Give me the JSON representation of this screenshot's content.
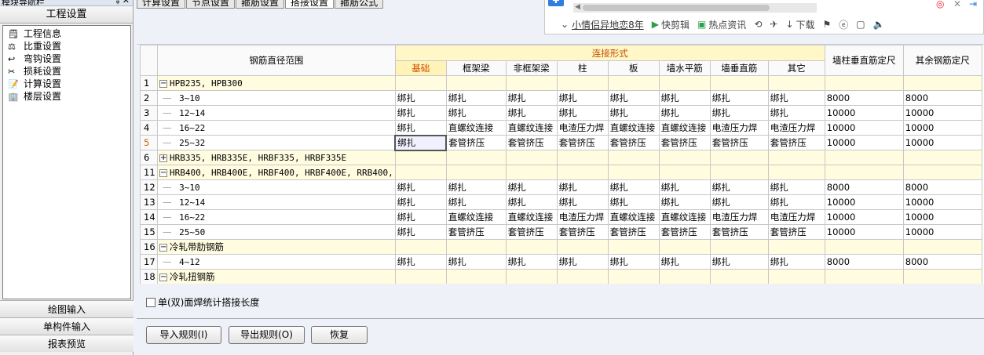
{
  "nav": {
    "window_title": "模块导航栏",
    "title_controls": "ᵩ ✕",
    "header": "工程设置",
    "items": [
      {
        "label": "工程信息",
        "icon": "info-doc-icon"
      },
      {
        "label": "比重设置",
        "icon": "weight-icon"
      },
      {
        "label": "弯钩设置",
        "icon": "hook-icon"
      },
      {
        "label": "损耗设置",
        "icon": "loss-icon"
      },
      {
        "label": "计算设置",
        "icon": "calc-icon"
      },
      {
        "label": "楼层设置",
        "icon": "floor-icon"
      }
    ],
    "bottom": [
      "绘图输入",
      "单构件输入",
      "报表预览"
    ]
  },
  "tabs": [
    {
      "label": "计算设置",
      "active": false
    },
    {
      "label": "节点设置",
      "active": false
    },
    {
      "label": "箍筋设置",
      "active": false
    },
    {
      "label": "搭接设置",
      "active": true
    },
    {
      "label": "箍筋公式",
      "active": false
    }
  ],
  "popup": {
    "news": "小情侣异地恋8年",
    "items": [
      "快剪辑",
      "热点资讯",
      "下载"
    ]
  },
  "grid": {
    "headers": {
      "range": "钢筋直径范围",
      "group": "连接形式",
      "sub": [
        "基础",
        "框架梁",
        "非框架梁",
        "柱",
        "板",
        "墙水平筋",
        "墙垂直筋",
        "其它"
      ],
      "wall": "墙柱垂直筋定尺",
      "other": "其余钢筋定尺"
    },
    "rows": [
      {
        "n": "1",
        "type": "group",
        "exp": "-",
        "label": "HPB235, HPB300"
      },
      {
        "n": "2",
        "type": "data",
        "label": "3~10",
        "cells": [
          "绑扎",
          "绑扎",
          "绑扎",
          "绑扎",
          "绑扎",
          "绑扎",
          "绑扎",
          "绑扎"
        ],
        "wall": "8000",
        "other": "8000"
      },
      {
        "n": "3",
        "type": "data",
        "label": "12~14",
        "cells": [
          "绑扎",
          "绑扎",
          "绑扎",
          "绑扎",
          "绑扎",
          "绑扎",
          "绑扎",
          "绑扎"
        ],
        "wall": "10000",
        "other": "10000"
      },
      {
        "n": "4",
        "type": "data",
        "label": "16~22",
        "cells": [
          "绑扎",
          "直螺纹连接",
          "直螺纹连接",
          "电渣压力焊",
          "直螺纹连接",
          "直螺纹连接",
          "电渣压力焊",
          "电渣压力焊"
        ],
        "wall": "10000",
        "other": "10000"
      },
      {
        "n": "5",
        "type": "data",
        "label": "25~32",
        "cur": true,
        "cells": [
          "绑扎",
          "套管挤压",
          "套管挤压",
          "套管挤压",
          "套管挤压",
          "套管挤压",
          "套管挤压",
          "套管挤压"
        ],
        "wall": "10000",
        "other": "10000"
      },
      {
        "n": "6",
        "type": "group",
        "exp": "+",
        "label": "HRB335, HRB335E, HRBF335, HRBF335E"
      },
      {
        "n": "11",
        "type": "group",
        "exp": "-",
        "label": "HRB400, HRB400E, HRBF400, HRBF400E, RRB400,"
      },
      {
        "n": "12",
        "type": "data",
        "label": "3~10",
        "cells": [
          "绑扎",
          "绑扎",
          "绑扎",
          "绑扎",
          "绑扎",
          "绑扎",
          "绑扎",
          "绑扎"
        ],
        "wall": "8000",
        "other": "8000"
      },
      {
        "n": "13",
        "type": "data",
        "label": "12~14",
        "cells": [
          "绑扎",
          "绑扎",
          "绑扎",
          "绑扎",
          "绑扎",
          "绑扎",
          "绑扎",
          "绑扎"
        ],
        "wall": "10000",
        "other": "10000"
      },
      {
        "n": "14",
        "type": "data",
        "label": "16~22",
        "cells": [
          "绑扎",
          "直螺纹连接",
          "直螺纹连接",
          "电渣压力焊",
          "直螺纹连接",
          "直螺纹连接",
          "电渣压力焊",
          "电渣压力焊"
        ],
        "wall": "10000",
        "other": "10000"
      },
      {
        "n": "15",
        "type": "data",
        "label": "25~50",
        "cells": [
          "绑扎",
          "套管挤压",
          "套管挤压",
          "套管挤压",
          "套管挤压",
          "套管挤压",
          "套管挤压",
          "套管挤压"
        ],
        "wall": "10000",
        "other": "10000"
      },
      {
        "n": "16",
        "type": "group",
        "exp": "-",
        "label": "冷轧带肋钢筋"
      },
      {
        "n": "17",
        "type": "data",
        "label": "4~12",
        "cells": [
          "绑扎",
          "绑扎",
          "绑扎",
          "绑扎",
          "绑扎",
          "绑扎",
          "绑扎",
          "绑扎"
        ],
        "wall": "8000",
        "other": "8000"
      },
      {
        "n": "18",
        "type": "group",
        "exp": "-",
        "label": "冷轧扭钢筋"
      }
    ]
  },
  "footer": {
    "checkbox_label": "单(双)面焊统计搭接长度",
    "checked": false,
    "buttons": [
      "导入规则(I)",
      "导出规则(O)",
      "恢复"
    ]
  }
}
